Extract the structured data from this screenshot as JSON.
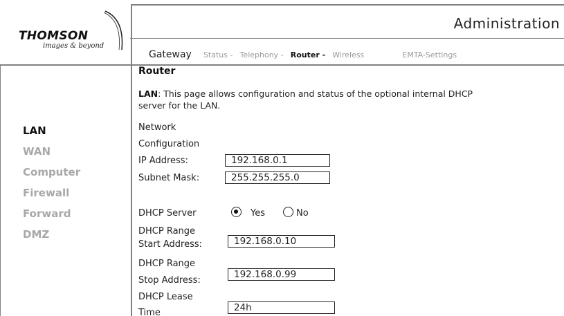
{
  "brand": {
    "name": "THOMSON",
    "tagline": "images & beyond"
  },
  "header": {
    "title": "Administration"
  },
  "nav": {
    "gateway": "Gateway",
    "items": [
      {
        "label": "Status -",
        "active": false
      },
      {
        "label": "Telephony -",
        "active": false
      },
      {
        "label": "Router -",
        "active": true
      },
      {
        "label": "Wireless",
        "active": false
      }
    ],
    "emta": "EMTA-Settings"
  },
  "sidebar": {
    "items": [
      {
        "label": "LAN",
        "active": true
      },
      {
        "label": "WAN",
        "active": false
      },
      {
        "label": "Computer",
        "active": false
      },
      {
        "label": "Firewall",
        "active": false
      },
      {
        "label": "Forward",
        "active": false
      },
      {
        "label": "DMZ",
        "active": false
      }
    ]
  },
  "main": {
    "section_title": "Router",
    "desc_bold": "LAN",
    "desc_text": ": This page allows configuration and status of the optional internal DHCP server for the LAN.",
    "network_label_1": "Network",
    "network_label_2": "Configuration",
    "ip_label": "IP Address:",
    "ip_value": "192.168.0.1",
    "subnet_label": "Subnet Mask:",
    "subnet_value": "255.255.255.0",
    "dhcp_server_label": "DHCP Server",
    "dhcp_yes": "Yes",
    "dhcp_no": "No",
    "dhcp_server_selected": "Yes",
    "start_label_1": "DHCP Range",
    "start_label_2": "Start Address:",
    "start_value": "192.168.0.10",
    "stop_label_1": "DHCP Range",
    "stop_label_2": "Stop Address:",
    "stop_value": "192.168.0.99",
    "lease_label_1": "DHCP Lease",
    "lease_label_2": "Time",
    "lease_value": "24h"
  }
}
